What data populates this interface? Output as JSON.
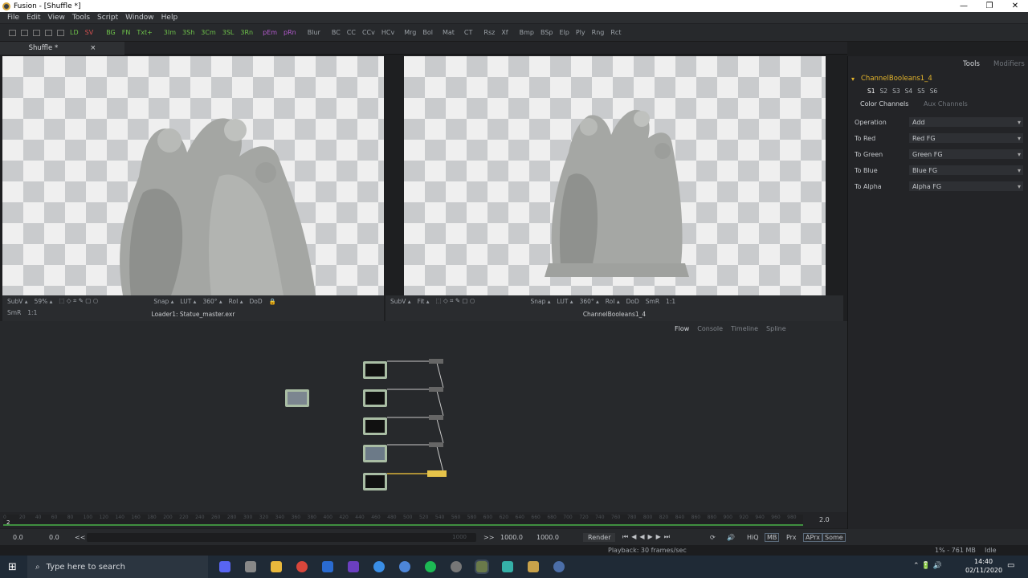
{
  "window": {
    "title": "Fusion - [Shuffle *]",
    "controls": [
      "—",
      "❐",
      "✕"
    ]
  },
  "menu": [
    "File",
    "Edit",
    "View",
    "Tools",
    "Script",
    "Window",
    "Help"
  ],
  "toolbar": {
    "buttons": [
      {
        "label": "LD",
        "color": "green"
      },
      {
        "label": "SV",
        "color": "red"
      },
      {
        "label": "BG",
        "color": "green"
      },
      {
        "label": "FN",
        "color": "green"
      },
      {
        "label": "Txt+",
        "color": "green"
      },
      {
        "label": "3Im",
        "color": "green"
      },
      {
        "label": "3Sh",
        "color": "green"
      },
      {
        "label": "3Cm",
        "color": "green"
      },
      {
        "label": "3SL",
        "color": "green"
      },
      {
        "label": "3Rn",
        "color": "green"
      },
      {
        "label": "pEm",
        "color": "purple"
      },
      {
        "label": "pRn",
        "color": "purple"
      },
      {
        "label": "Blur",
        "color": "grey"
      },
      {
        "label": "BC",
        "color": "grey"
      },
      {
        "label": "CC",
        "color": "grey"
      },
      {
        "label": "CCv",
        "color": "grey"
      },
      {
        "label": "HCv",
        "color": "grey"
      },
      {
        "label": "Mrg",
        "color": "grey"
      },
      {
        "label": "Bol",
        "color": "grey"
      },
      {
        "label": "Mat",
        "color": "grey"
      },
      {
        "label": "CT",
        "color": "grey"
      },
      {
        "label": "Rsz",
        "color": "grey"
      },
      {
        "label": "Xf",
        "color": "grey"
      },
      {
        "label": "Bmp",
        "color": "grey"
      },
      {
        "label": "BSp",
        "color": "grey"
      },
      {
        "label": "Elp",
        "color": "grey"
      },
      {
        "label": "Ply",
        "color": "grey"
      },
      {
        "label": "Rng",
        "color": "grey"
      },
      {
        "label": "Rct",
        "color": "grey"
      }
    ]
  },
  "doc_tab": {
    "label": "Shuffle *",
    "close": "×"
  },
  "viewer_left": {
    "controls": [
      "SubV ▴",
      "59% ▴",
      "Snap ▴",
      "LUT ▴",
      "360° ▴",
      "RoI ▴",
      "DoD"
    ],
    "controls2": [
      "SmR",
      "1:1"
    ],
    "caption": "Loader1: Statue_master.exr"
  },
  "viewer_right": {
    "controls": [
      "SubV ▴",
      "Fit ▴",
      "Snap ▴",
      "LUT ▴",
      "360° ▴",
      "RoI ▴",
      "DoD",
      "SmR",
      "1:1"
    ],
    "caption": "ChannelBooleans1_4"
  },
  "inspector": {
    "tabs": [
      "Tools",
      "Modifiers"
    ],
    "node_name": "ChannelBooleans1_4",
    "versions": [
      "S1",
      "S2",
      "S3",
      "S4",
      "S5",
      "S6"
    ],
    "subtabs": [
      "Color Channels",
      "Aux Channels"
    ],
    "fields": [
      {
        "label": "Operation",
        "value": "Add"
      },
      {
        "label": "To Red",
        "value": "Red   FG"
      },
      {
        "label": "To Green",
        "value": "Green  FG"
      },
      {
        "label": "To Blue",
        "value": "Blue   FG"
      },
      {
        "label": "To Alpha",
        "value": "Alpha  FG"
      }
    ]
  },
  "flow_tabs": [
    "Flow",
    "Console",
    "Timeline",
    "Spline"
  ],
  "timeline": {
    "ticks": [
      "0",
      "20",
      "40",
      "60",
      "80",
      "100",
      "120",
      "140",
      "160",
      "180",
      "200",
      "220",
      "240",
      "260",
      "280",
      "300",
      "320",
      "340",
      "360",
      "380",
      "400",
      "420",
      "440",
      "460",
      "480",
      "500",
      "520",
      "540",
      "560",
      "580",
      "600",
      "620",
      "640",
      "660",
      "680",
      "700",
      "720",
      "740",
      "760",
      "780",
      "800",
      "820",
      "840",
      "860",
      "880",
      "900",
      "920",
      "940",
      "960",
      "980"
    ],
    "current": "2",
    "end_value": "2.0"
  },
  "transport": {
    "start": "0.0",
    "render_start": "0.0",
    "prev": "<<",
    "range_end_ghost": "1000",
    "next": ">>",
    "render_end": "1000.0",
    "end": "1000.0",
    "render": "Render",
    "hiq": "HiQ",
    "mb": "MB",
    "prx": "Prx",
    "aprx": "APrx",
    "some": "Some"
  },
  "status": {
    "playback": "Playback: 30 frames/sec",
    "memory": "1% - 761 MB",
    "state": "Idle"
  },
  "taskbar": {
    "search_placeholder": "Type here to search",
    "time": "14:40",
    "date": "02/11/2020"
  }
}
